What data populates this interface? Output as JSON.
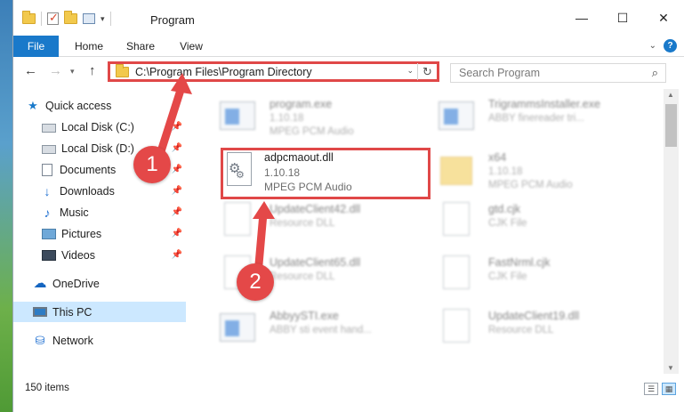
{
  "window": {
    "title": "Program",
    "qat_dropdown": "▾",
    "controls": {
      "minimize": "—",
      "maximize": "☐",
      "close": "✕"
    }
  },
  "ribbon": {
    "tabs": [
      "File",
      "Home",
      "Share",
      "View"
    ],
    "expand": "⌄",
    "help": "?"
  },
  "nav": {
    "back": "←",
    "forward": "→",
    "recent": "▾",
    "up": "↑",
    "address": "C:\\Program Files\\Program Directory",
    "address_dropdown": "⌄",
    "refresh": "↻",
    "search_placeholder": "Search Program",
    "search_icon": "⌕"
  },
  "sidebar": {
    "items": [
      {
        "label": "Quick access",
        "icon": "star-icon",
        "pinned": false
      },
      {
        "label": "Local Disk (C:)",
        "icon": "drive-icon",
        "pinned": true
      },
      {
        "label": "Local Disk (D:)",
        "icon": "drive-icon",
        "pinned": true
      },
      {
        "label": "Documents",
        "icon": "document-icon",
        "pinned": true
      },
      {
        "label": "Downloads",
        "icon": "download-icon",
        "pinned": true
      },
      {
        "label": "Music",
        "icon": "music-icon",
        "pinned": true
      },
      {
        "label": "Pictures",
        "icon": "pictures-icon",
        "pinned": true
      },
      {
        "label": "Videos",
        "icon": "video-icon",
        "pinned": true
      },
      {
        "label": "OneDrive",
        "icon": "cloud-icon",
        "pinned": false
      },
      {
        "label": "This PC",
        "icon": "computer-icon",
        "pinned": false,
        "selected": true
      },
      {
        "label": "Network",
        "icon": "network-icon",
        "pinned": false
      }
    ],
    "pin_glyph": "📌"
  },
  "files": {
    "left_column": [
      {
        "name": "program.exe",
        "version": "1.10.18",
        "desc": "MPEG PCM Audio",
        "kind": "exe"
      },
      {
        "name": "adpcmaout.dll",
        "version": "1.10.18",
        "desc": "MPEG PCM Audio",
        "kind": "dll"
      },
      {
        "name": "UpdateClient42.dll",
        "version": "",
        "desc": "Resource DLL",
        "kind": "dll"
      },
      {
        "name": "UpdateClient65.dll",
        "version": "",
        "desc": "Resource DLL",
        "kind": "dll"
      },
      {
        "name": "AbbyySTI.exe",
        "version": "",
        "desc": "ABBY sti event hand...",
        "kind": "exe"
      }
    ],
    "right_column": [
      {
        "name": "TrigrammsInstaller.exe",
        "version": "",
        "desc": "ABBY finereader tri...",
        "kind": "exe"
      },
      {
        "name": "x64",
        "version": "1.10.18",
        "desc": "MPEG PCM Audio",
        "kind": "zip"
      },
      {
        "name": "gtd.cjk",
        "version": "",
        "desc": "CJK File",
        "kind": "doc"
      },
      {
        "name": "FastNrml.cjk",
        "version": "",
        "desc": "CJK File",
        "kind": "doc"
      },
      {
        "name": "UpdateClient19.dll",
        "version": "",
        "desc": "Resource DLL",
        "kind": "dll"
      }
    ],
    "highlighted_index": 1
  },
  "status": {
    "item_count": "150 items"
  },
  "annotations": {
    "badge1": "1",
    "badge2": "2",
    "color": "#e44848"
  },
  "colors": {
    "accent": "#1979ca",
    "selection": "#cce8ff",
    "highlight": "#e04848"
  }
}
